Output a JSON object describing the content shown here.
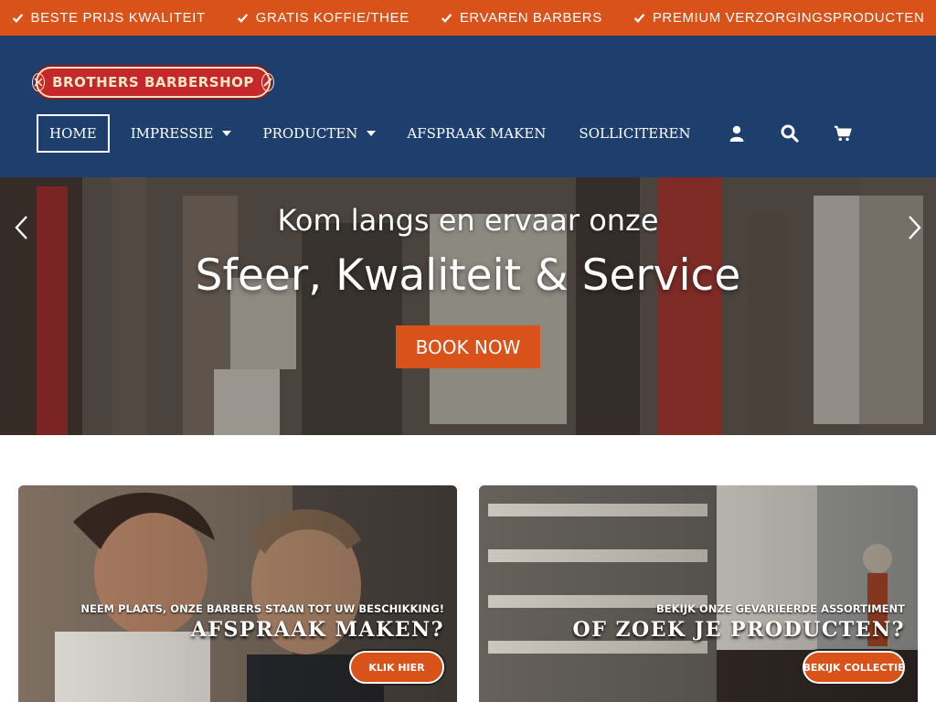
{
  "usps": [
    {
      "label": "BESTE PRIJS KWALITEIT",
      "icon": "check-icon"
    },
    {
      "label": "GRATIS KOFFIE/THEE",
      "icon": "check-icon"
    },
    {
      "label": "ERVAREN BARBERS",
      "icon": "check-icon"
    },
    {
      "label": "PREMIUM VERZORGINGSPRODUCTEN",
      "icon": "check-icon"
    }
  ],
  "logo": {
    "text": "BROTHERS BARBERSHOP"
  },
  "nav": {
    "home": "HOME",
    "impressie": "IMPRESSIE",
    "producten": "PRODUCTEN",
    "afspraak": "AFSPRAAK MAKEN",
    "solliciteren": "SOLLICITEREN",
    "icons": [
      "user-icon",
      "search-icon",
      "cart-icon"
    ]
  },
  "hero": {
    "subtitle": "Kom langs en ervaar onze",
    "title": "Sfeer, Kwaliteit & Service",
    "button": "BOOK NOW"
  },
  "cards": [
    {
      "subtitle": "NEEM PLAATS, ONZE BARBERS STAAN TOT UW BESCHIKKING!",
      "title": "AFSPRAAK MAKEN?",
      "button": "KLIK HIER"
    },
    {
      "subtitle": "BEKIJK ONZE GEVARIEERDE ASSORTIMENT",
      "title": "OF ZOEK JE PRODUCTEN?",
      "button": "BEKIJK COLLECTIE"
    }
  ],
  "colors": {
    "accent": "#d9521a",
    "header": "#1e3f6d",
    "logo_red": "#c5282a"
  }
}
